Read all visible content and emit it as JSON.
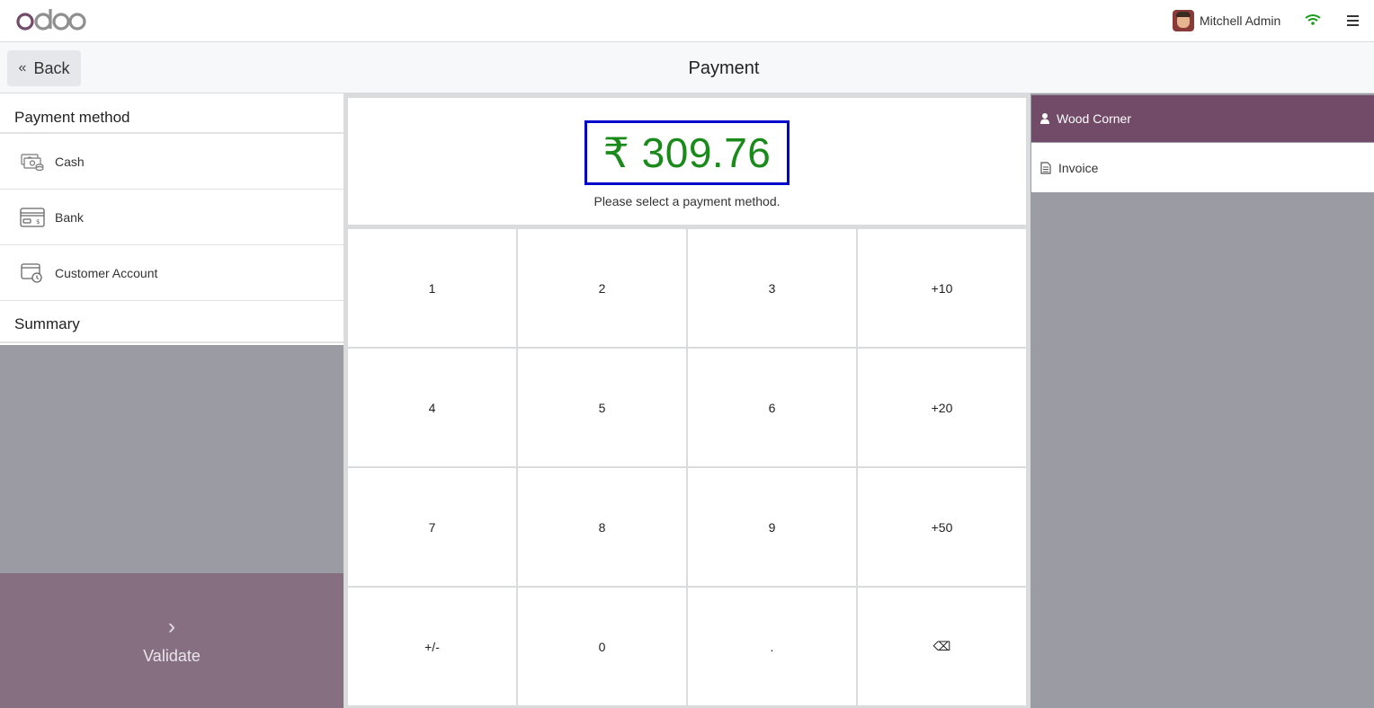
{
  "header": {
    "logo_text": "odoo",
    "user_name": "Mitchell Admin",
    "status_color": "#1a9e1a"
  },
  "subheader": {
    "back_label": "Back",
    "title": "Payment"
  },
  "left": {
    "payment_method_title": "Payment method",
    "methods": [
      {
        "label": "Cash",
        "icon": "cash-icon"
      },
      {
        "label": "Bank",
        "icon": "bank-card-icon"
      },
      {
        "label": "Customer Account",
        "icon": "customer-account-icon"
      }
    ],
    "summary_title": "Summary",
    "validate_label": "Validate"
  },
  "center": {
    "amount": "₹ 309.76",
    "hint": "Please select a payment method.",
    "keys": [
      "1",
      "2",
      "3",
      "+10",
      "4",
      "5",
      "6",
      "+20",
      "7",
      "8",
      "9",
      "+50",
      "+/-",
      "0",
      ".",
      "⌫"
    ]
  },
  "right": {
    "customer": "Wood Corner",
    "invoice_label": "Invoice"
  },
  "colors": {
    "brand": "#714b67",
    "amount": "#1a8a1a",
    "amount_border": "#0000cc",
    "validate_bg": "#856f81",
    "panel_grey": "#9a9ba3"
  }
}
